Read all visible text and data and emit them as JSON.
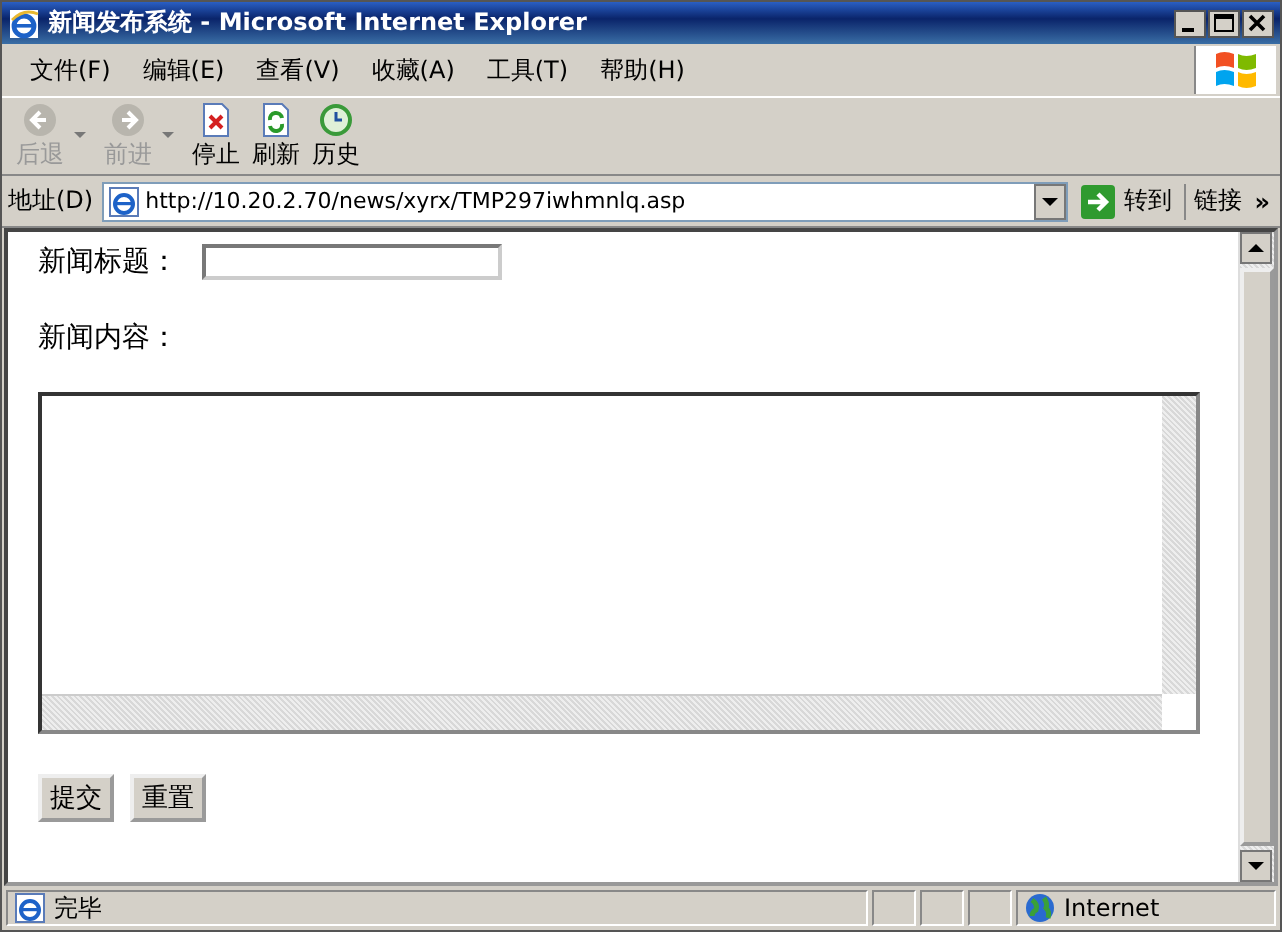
{
  "window": {
    "title": "新闻发布系统 - Microsoft Internet Explorer"
  },
  "menu": [
    "文件(F)",
    "编辑(E)",
    "查看(V)",
    "收藏(A)",
    "工具(T)",
    "帮助(H)"
  ],
  "toolbar": [
    {
      "kind": "back",
      "label": "后退",
      "disabled": true,
      "dropdown": true
    },
    {
      "kind": "forward",
      "label": "前进",
      "disabled": true,
      "dropdown": true
    },
    {
      "kind": "stop",
      "label": "停止",
      "disabled": false,
      "dropdown": false
    },
    {
      "kind": "refresh",
      "label": "刷新",
      "disabled": false,
      "dropdown": false
    },
    {
      "kind": "history",
      "label": "历史",
      "disabled": false,
      "dropdown": false
    }
  ],
  "address_bar": {
    "label": "地址(D)",
    "url": "http://10.20.2.70/news/xyrx/TMP297iwhmnlq.asp",
    "go": "转到",
    "links": "链接",
    "more": "»"
  },
  "form": {
    "title_label": "新闻标题：",
    "content_label": "新闻内容：",
    "buttons": [
      "提交",
      "重置"
    ]
  },
  "status_bar": {
    "text": "完毕",
    "zone": "Internet"
  }
}
